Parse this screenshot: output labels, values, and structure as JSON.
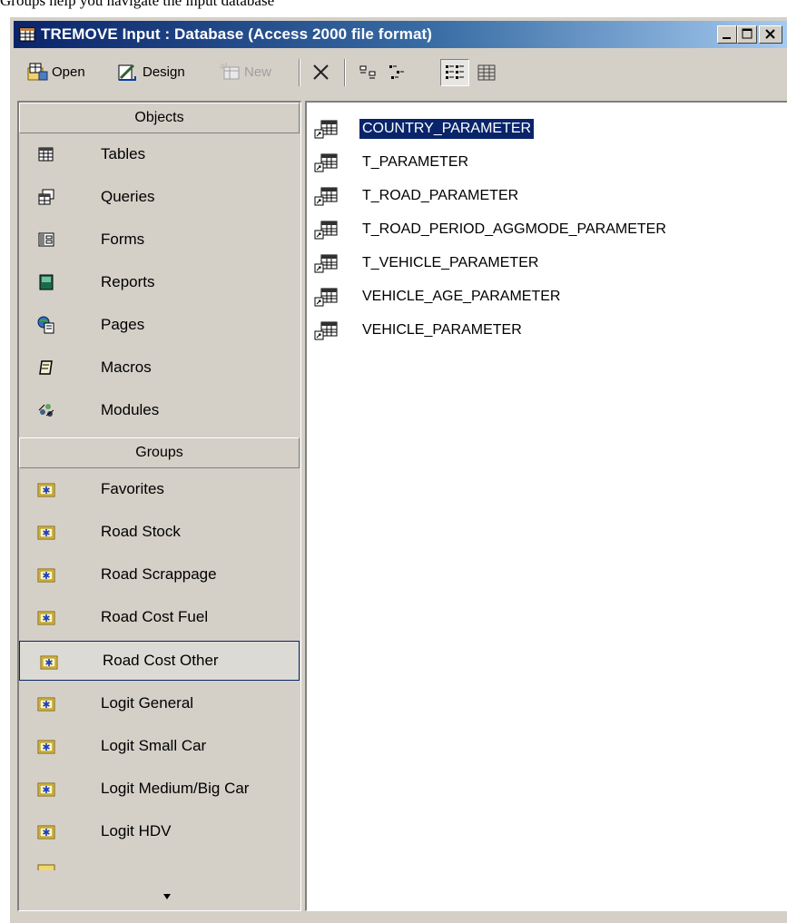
{
  "caption": "Groups help you navigate the input database",
  "window": {
    "title": "TREMOVE Input : Database (Access 2000 file format)"
  },
  "toolbar": {
    "open_label": "Open",
    "design_label": "Design",
    "new_label": "New"
  },
  "objects": {
    "header": "Objects",
    "items": [
      {
        "label": "Tables",
        "icon": "table-icon"
      },
      {
        "label": "Queries",
        "icon": "query-icon"
      },
      {
        "label": "Forms",
        "icon": "form-icon"
      },
      {
        "label": "Reports",
        "icon": "report-icon"
      },
      {
        "label": "Pages",
        "icon": "page-icon"
      },
      {
        "label": "Macros",
        "icon": "macro-icon"
      },
      {
        "label": "Modules",
        "icon": "module-icon"
      }
    ]
  },
  "groups": {
    "header": "Groups",
    "items": [
      {
        "label": "Favorites"
      },
      {
        "label": "Road Stock"
      },
      {
        "label": "Road Scrappage"
      },
      {
        "label": "Road Cost Fuel"
      },
      {
        "label": "Road Cost Other",
        "selected": true
      },
      {
        "label": "Logit General"
      },
      {
        "label": "Logit Small Car"
      },
      {
        "label": "Logit Medium/Big Car"
      },
      {
        "label": "Logit HDV"
      }
    ]
  },
  "tables": [
    {
      "label": "COUNTRY_PARAMETER",
      "selected": true
    },
    {
      "label": "T_PARAMETER"
    },
    {
      "label": "T_ROAD_PARAMETER"
    },
    {
      "label": "T_ROAD_PERIOD_AGGMODE_PARAMETER"
    },
    {
      "label": "T_VEHICLE_PARAMETER"
    },
    {
      "label": "VEHICLE_AGE_PARAMETER"
    },
    {
      "label": "VEHICLE_PARAMETER"
    }
  ],
  "colors": {
    "title_start": "#0a246a",
    "title_end": "#a6caf0",
    "face": "#d4d0c8",
    "selection": "#0a246a"
  }
}
